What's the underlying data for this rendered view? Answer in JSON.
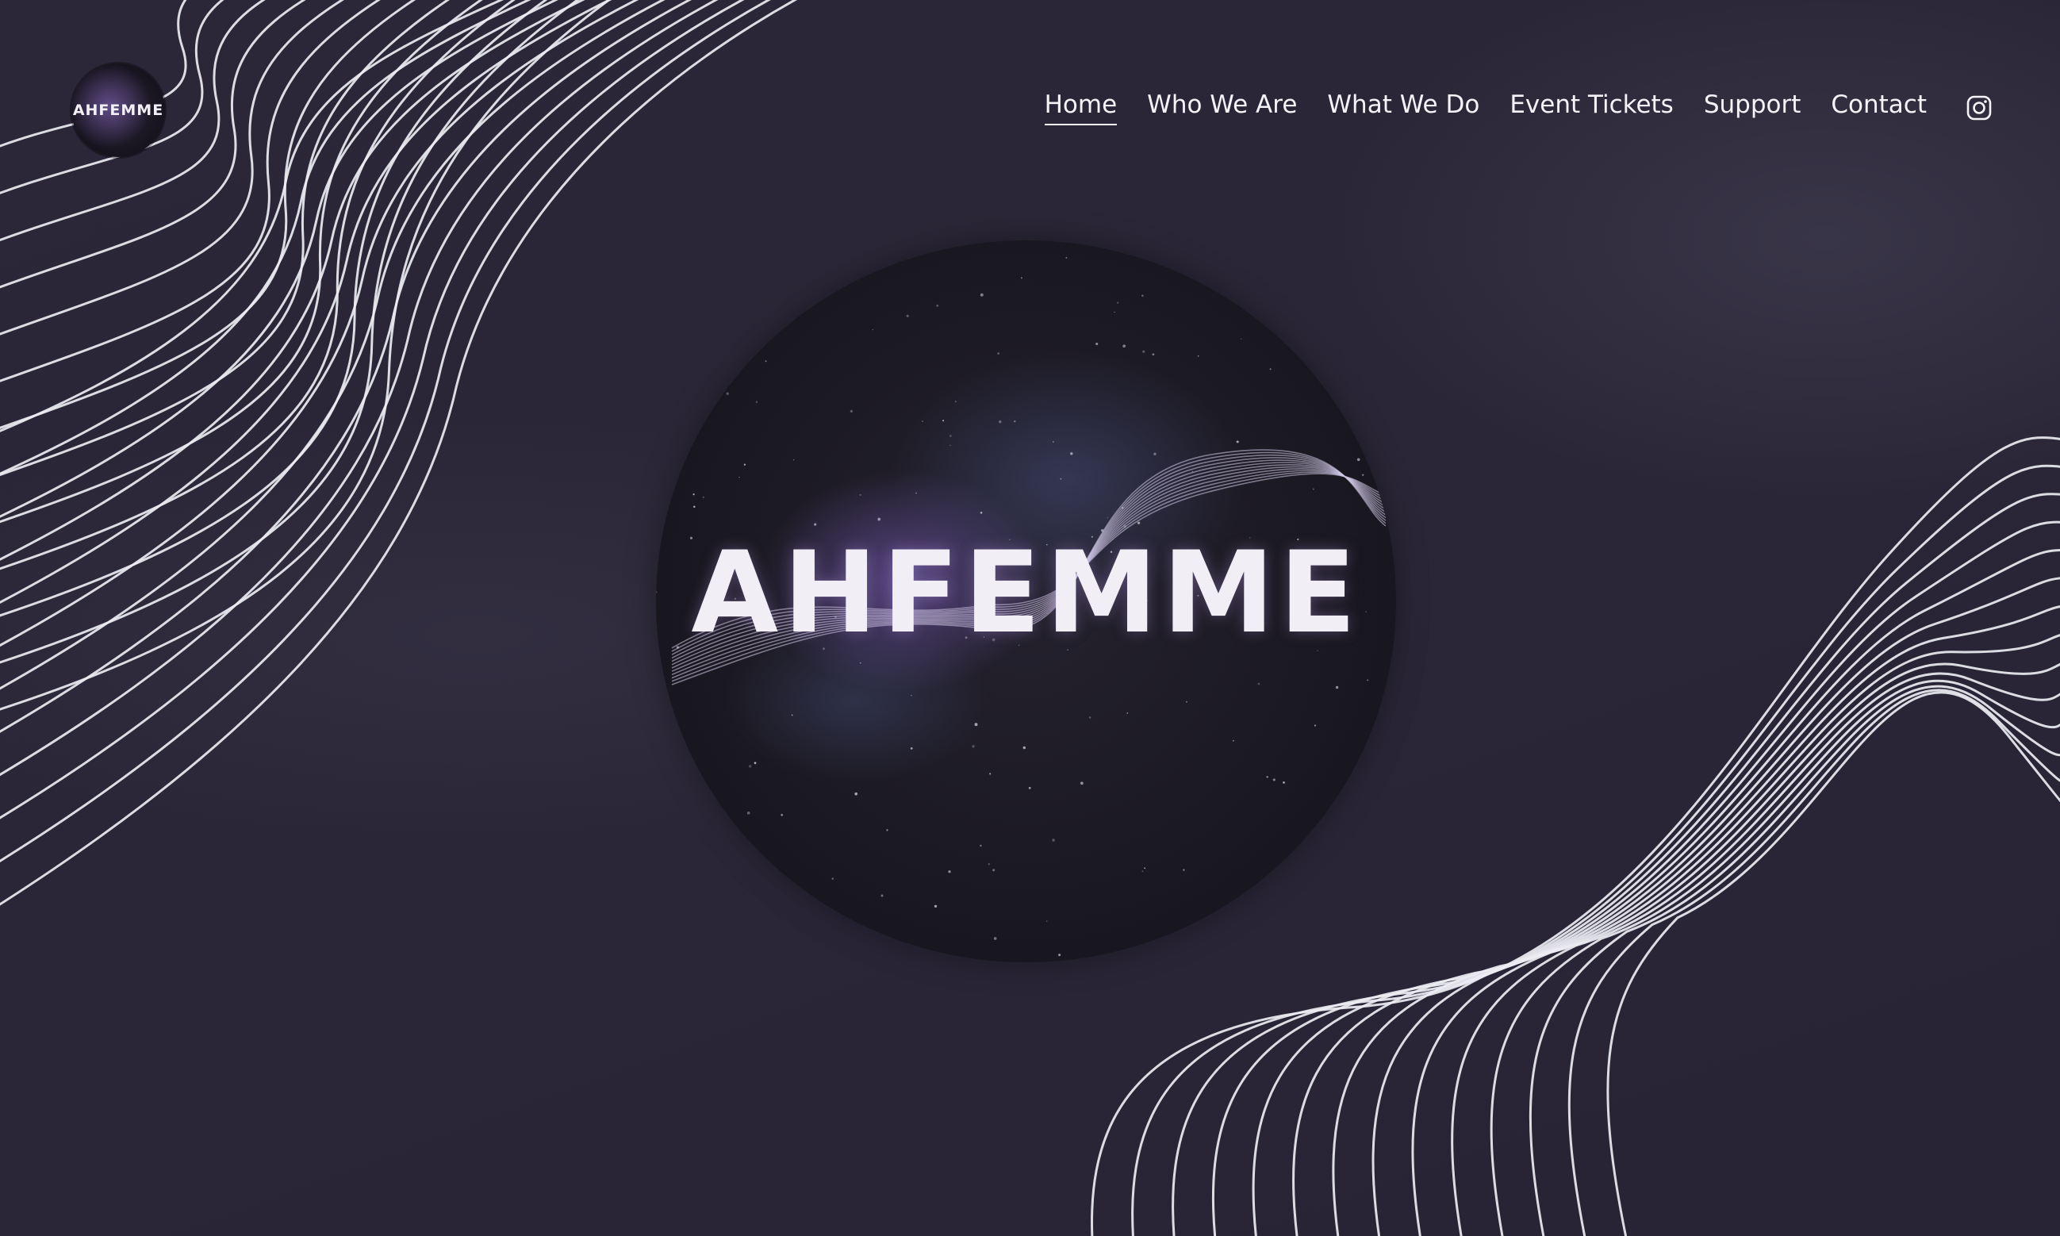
{
  "brand": {
    "logo_text": "AHFEMME"
  },
  "nav": {
    "items": [
      {
        "label": "Home",
        "active": true
      },
      {
        "label": "Who We Are",
        "active": false
      },
      {
        "label": "What We Do",
        "active": false
      },
      {
        "label": "Event Tickets",
        "active": false
      },
      {
        "label": "Support",
        "active": false
      },
      {
        "label": "Contact",
        "active": false
      }
    ],
    "social_icon": "instagram-icon"
  },
  "hero": {
    "title": "AHFEMME"
  },
  "colors": {
    "background": "#29253a",
    "text": "#f4f3f7",
    "lines": "#ececf2"
  }
}
